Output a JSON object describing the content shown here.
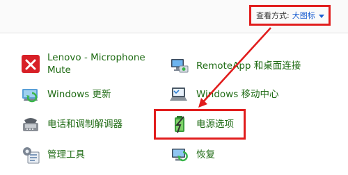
{
  "header": {
    "view_label": "查看方式:",
    "view_value": "大图标"
  },
  "items": {
    "lenovo_mute": {
      "line1": "Lenovo - Microphone",
      "line2": "Mute",
      "icon": "lenovo-microphone-mute-icon"
    },
    "remoteapp": {
      "label": "RemoteApp 和桌面连接",
      "icon": "remoteapp-icon"
    },
    "windows_update": {
      "label": "Windows 更新",
      "icon": "windows-update-icon"
    },
    "mobility_center": {
      "label": "Windows 移动中心",
      "icon": "mobility-center-icon"
    },
    "phone_modem": {
      "label": "电话和调制解调器",
      "icon": "phone-modem-icon"
    },
    "power_options": {
      "label": "电源选项",
      "icon": "power-options-icon"
    },
    "admin_tools": {
      "label": "管理工具",
      "icon": "admin-tools-icon"
    },
    "recovery": {
      "label": "恢复",
      "icon": "recovery-icon"
    }
  },
  "colors": {
    "link_green": "#1f6b14",
    "highlight_red": "#e11d1d",
    "view_blue": "#1c5fd1"
  }
}
